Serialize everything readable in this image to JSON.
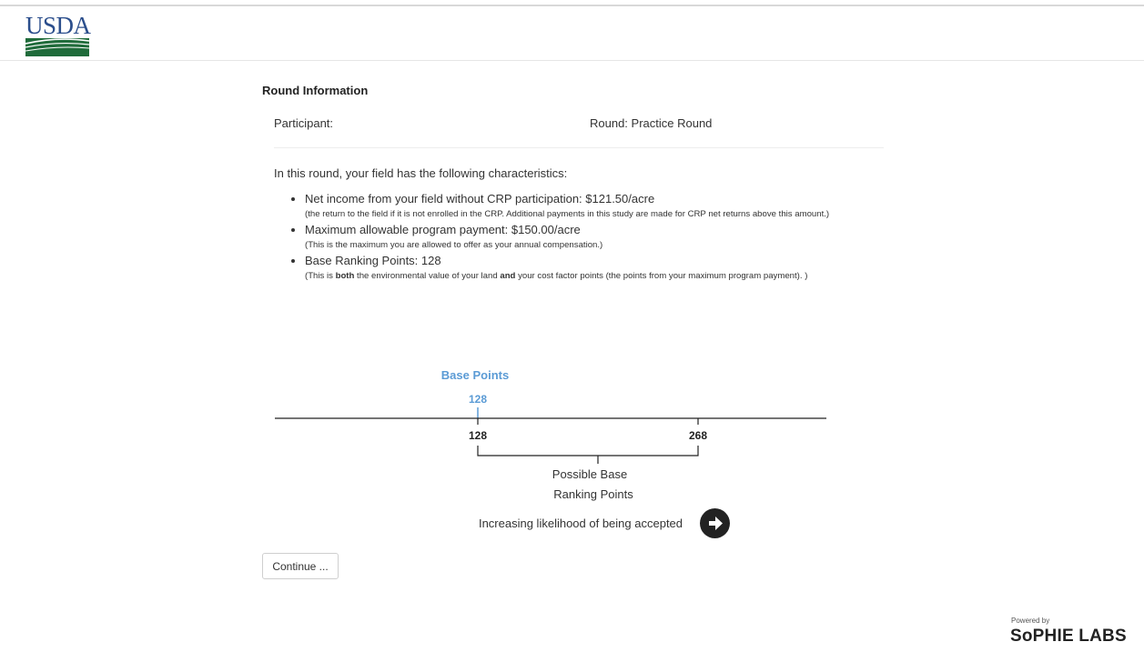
{
  "header": {
    "logo_text": "USDA",
    "colors": {
      "logo_blue": "#2b4e8c",
      "logo_green": "#1f6b3a"
    }
  },
  "round_info": {
    "title": "Round Information",
    "participant_label": "Participant:",
    "round_label": "Round: Practice Round"
  },
  "characteristics": {
    "intro": "In this round, your field has the following characteristics:",
    "items": [
      {
        "main": "Net income from your field without CRP participation: $121.50/acre",
        "note": "(the return to the field if it is not enrolled in the CRP. Additional payments in this study are made for CRP net returns above this amount.)"
      },
      {
        "main": "Maximum allowable program payment: $150.00/acre",
        "note": "(This is the maximum you are allowed to offer as your annual compensation.)"
      },
      {
        "main": "Base Ranking Points: 128",
        "note_prefix": "(This is ",
        "note_bold1": "both",
        "note_mid": " the environmental value of your land ",
        "note_bold2": "and",
        "note_suffix": " your cost factor points (the points from your maximum program payment). )"
      }
    ]
  },
  "base_points": {
    "title": "Base Points",
    "marker_value": "128",
    "min_label": "128",
    "max_label": "268",
    "range_label_line1": "Possible Base",
    "range_label_line2": "Ranking Points",
    "likelihood_text": "Increasing likelihood of being accepted",
    "arrow_icon": "arrow-right-icon",
    "colors": {
      "accent": "#5b9bd5",
      "axis": "#222222"
    }
  },
  "actions": {
    "continue_label": "Continue ..."
  },
  "footer": {
    "powered_by": "Powered by",
    "brand": "SoPHIE LABS"
  }
}
